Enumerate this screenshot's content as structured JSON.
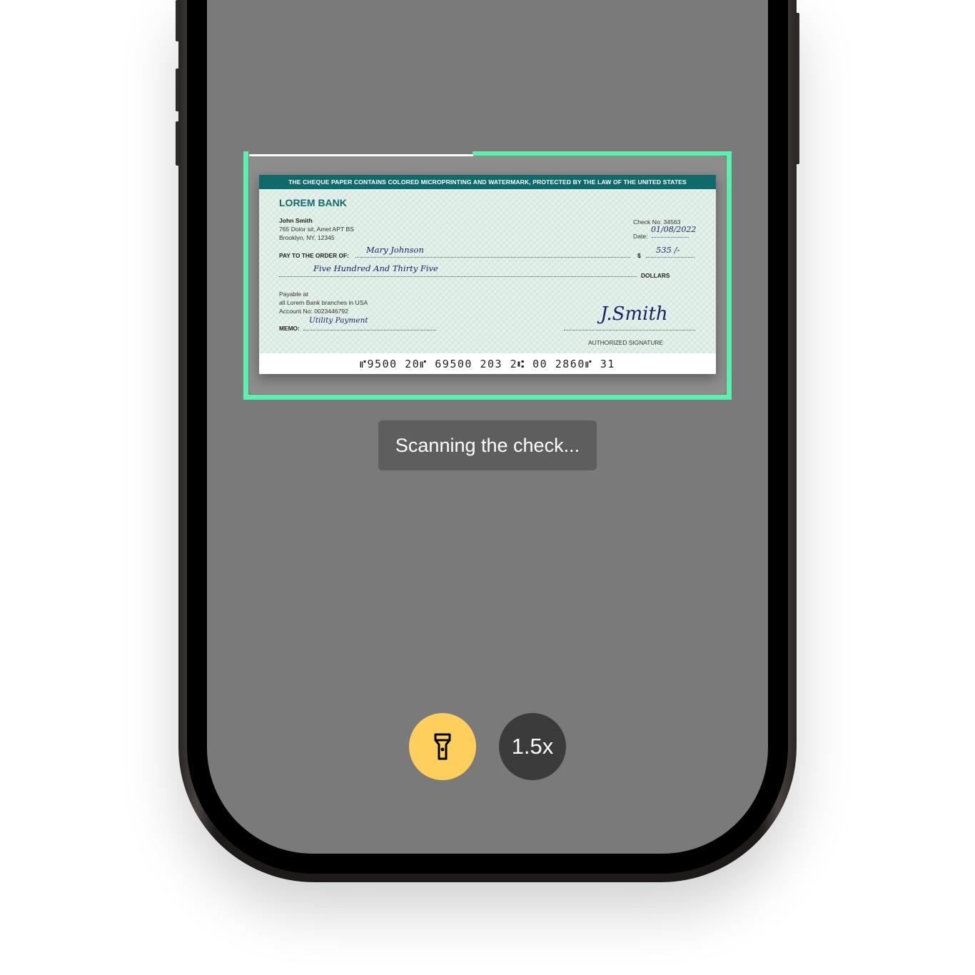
{
  "cheque": {
    "banner": "THE CHEQUE PAPER CONTAINS COLORED MICROPRINTING AND WATERMARK, PROTECTED BY THE LAW OF THE UNITED STATES",
    "bank_name": "LOREM BANK",
    "owner_name": "John Smith",
    "owner_address_1": "765 Dolor sit, Amet APT BS",
    "owner_address_2": "Brooklyn, NY, 12345",
    "check_no_label": "Check No: 34563",
    "date_label": "Date:",
    "date_value": "01/08/2022",
    "pay_to_label": "PAY TO THE ORDER OF:",
    "payee": "Mary Johnson",
    "dollar_sign": "$",
    "amount": "535 /-",
    "amount_words": "Five Hundred And Thirty Five",
    "dollars_label": "DOLLARS",
    "payable_1": "Payable at",
    "payable_2": "all Lorem Bank branches in USA",
    "account_no": "Account No: 0023446792",
    "memo_label": "MEMO:",
    "memo_value": "Utility Payment",
    "signature": "J.Smith",
    "signature_label": "AUTHORIZED SIGNATURE",
    "micr": "⑈9500 20⑈  69500 203 2⑆  00 2860⑈  31"
  },
  "status": {
    "text": "Scanning the check..."
  },
  "controls": {
    "flash_icon": "flashlight-icon",
    "zoom_label": "1.5x",
    "flash_color": "#fecf5c",
    "zoom_bg": "#3b3b3b",
    "scan_border_color": "#5af0ad"
  }
}
